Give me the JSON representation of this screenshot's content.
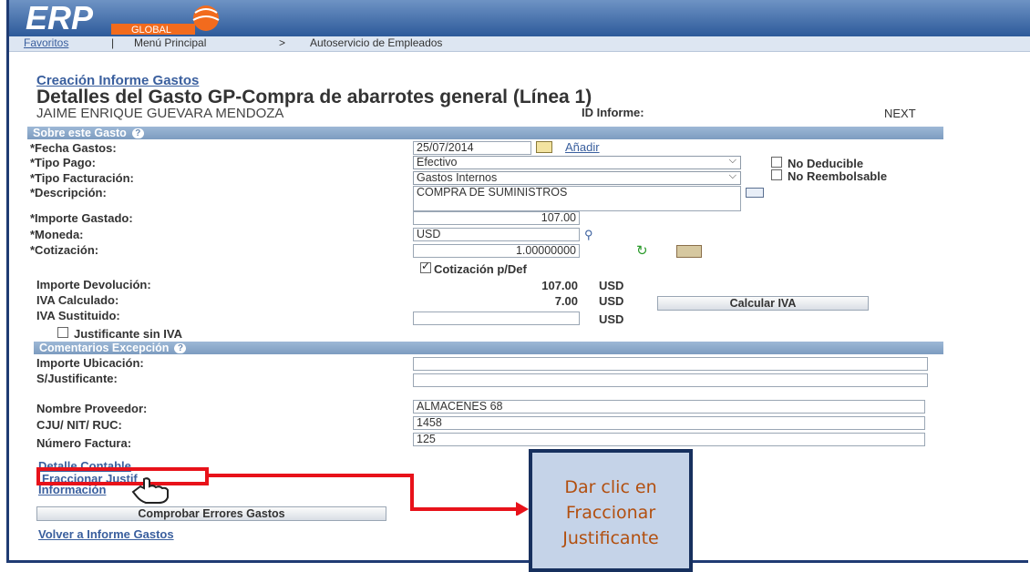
{
  "header": {
    "logo_text": "ERP",
    "logo_sub": "GLOBAL"
  },
  "menubar": {
    "favoritos": "Favoritos",
    "menu_principal": "Menú Principal",
    "separator": ">",
    "autoservicio": "Autoservicio de Empleados"
  },
  "page": {
    "breadcrumb_link": "Creación Informe Gastos",
    "title": "Detalles del Gasto GP-Compra de abarrotes general (Línea 1)",
    "employee": "JAIME ENRIQUE GUEVARA MENDOZA",
    "id_informe_label": "ID Informe:",
    "id_informe_value": "NEXT"
  },
  "section1": {
    "title": "Sobre este Gasto"
  },
  "form": {
    "fecha_label": "*Fecha Gastos:",
    "fecha_value": "25/07/2014",
    "anadir": "Añadir",
    "tipo_pago_label": "*Tipo Pago:",
    "tipo_pago_value": "Efectivo",
    "tipo_fact_label": "*Tipo Facturación:",
    "tipo_fact_value": "Gastos Internos",
    "no_deducible": "No Deducible",
    "no_reembolsable": "No Reembolsable",
    "descripcion_label": "*Descripción:",
    "descripcion_value": "COMPRA DE SUMINISTROS",
    "importe_label": "*Importe Gastado:",
    "importe_value": "107.00",
    "moneda_label": "*Moneda:",
    "moneda_value": "USD",
    "cotizacion_label": "*Cotización:",
    "cotizacion_value": "1.00000000",
    "cotizacion_def": "Cotización p/Def",
    "devolucion_label": "Importe Devolución:",
    "devolucion_value": "107.00",
    "devolucion_cur": "USD",
    "iva_calc_label": "IVA Calculado:",
    "iva_calc_value": "7.00",
    "iva_calc_cur": "USD",
    "calcular_iva": "Calcular IVA",
    "iva_sust_label": "IVA Sustituido:",
    "iva_sust_cur": "USD",
    "justificante_sin_iva": "Justificante sin IVA"
  },
  "section2": {
    "title": "Comentarios Excepción"
  },
  "form2": {
    "importe_ubic_label": "Importe Ubicación:",
    "sjustificante_label": "S/Justificante:",
    "proveedor_label": "Nombre Proveedor:",
    "proveedor_value": "ALMACENES 68",
    "cju_label": "CJU/ NIT/ RUC:",
    "cju_value": "1458",
    "factura_label": "Número Factura:",
    "factura_value": "125"
  },
  "links": {
    "detalle_contable": "Detalle Contable",
    "fraccionar": "Fraccionar Justif",
    "informacion": "Información",
    "comprobar": "Comprobar Errores Gastos",
    "volver": "Volver a Informe Gastos"
  },
  "callout": {
    "line1": "Dar clic en",
    "line2": "Fraccionar",
    "line3": "Justificante"
  },
  "colors": {
    "accent_red": "#e8121a",
    "callout_bg": "#c5d3e8",
    "callout_border": "#17305e",
    "callout_text": "#b24f0f"
  }
}
